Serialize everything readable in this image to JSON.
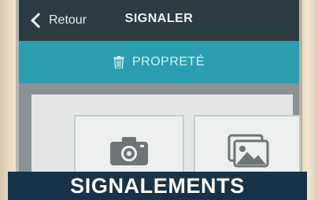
{
  "navbar": {
    "back_label": "Retour",
    "title": "SIGNALER"
  },
  "category": {
    "label": "PROPRETÉ",
    "icon": "trash-icon"
  },
  "options": [
    {
      "icon": "camera-icon"
    },
    {
      "icon": "gallery-icon"
    }
  ],
  "banner": {
    "text": "SIGNALEMENTS"
  },
  "colors": {
    "navbar": "#2d3b42",
    "category_bar": "#2a9eaf",
    "banner": "#18324a"
  }
}
